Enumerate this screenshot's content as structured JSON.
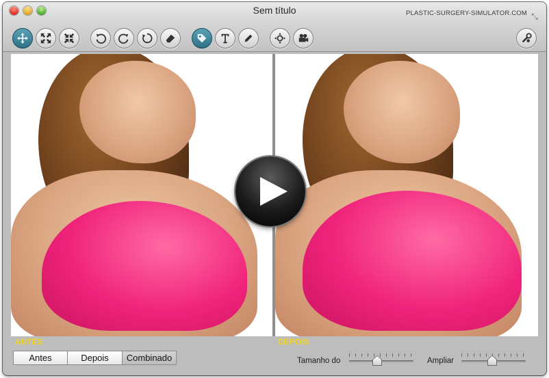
{
  "window": {
    "title": "Sem título",
    "brand": "PLASTIC-SURGERY-SIMULATOR.COM"
  },
  "toolbar": {
    "buttons": [
      {
        "name": "move-tool",
        "icon": "move-arrows-icon",
        "active": true
      },
      {
        "name": "expand-tool",
        "icon": "expand-icon",
        "active": false
      },
      {
        "name": "contract-tool",
        "icon": "contract-icon",
        "active": false
      },
      {
        "name": "undo",
        "icon": "undo-icon",
        "active": false
      },
      {
        "name": "redo",
        "icon": "redo-icon",
        "active": false
      },
      {
        "name": "reset",
        "icon": "reset-icon",
        "active": false
      },
      {
        "name": "eraser",
        "icon": "eraser-icon",
        "active": false
      },
      {
        "name": "tag-tool",
        "icon": "tag-icon",
        "active": true
      },
      {
        "name": "text-tool",
        "icon": "text-icon",
        "active": false
      },
      {
        "name": "pencil-tool",
        "icon": "pencil-icon",
        "active": false
      },
      {
        "name": "zoom-tool",
        "icon": "crosshair-zoom-icon",
        "active": false
      },
      {
        "name": "video-tool",
        "icon": "video-camera-icon",
        "active": false
      },
      {
        "name": "settings",
        "icon": "settings-tools-icon",
        "active": false
      }
    ]
  },
  "panels": {
    "before_label": "ANTES",
    "after_label": "DEPOIS"
  },
  "view_modes": {
    "options": [
      "Antes",
      "Depois",
      "Combinado"
    ],
    "selected": "Combinado"
  },
  "sliders": {
    "size": {
      "label": "Tamanho do",
      "value": 0.42
    },
    "zoom": {
      "label": "Ampliar",
      "value": 0.48
    }
  },
  "colors": {
    "label_yellow": "#f2d21b",
    "active_button": "#2c6f85",
    "top_pink": "#f0237a"
  }
}
